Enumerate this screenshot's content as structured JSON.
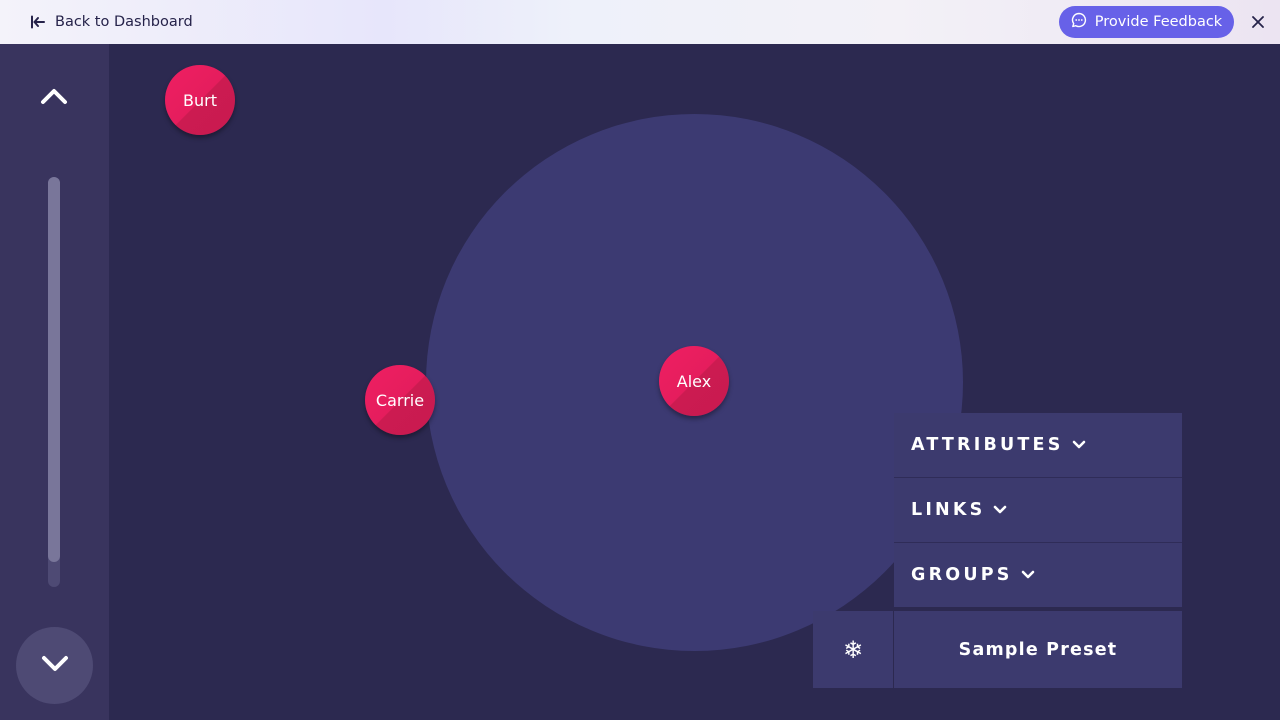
{
  "topbar": {
    "back_label": "Back to Dashboard",
    "feedback_label": "Provide Feedback",
    "accent": "#6761e8"
  },
  "sidebar": {
    "zoom_level": 0.94
  },
  "map": {
    "nodes": [
      {
        "label": "Burt"
      },
      {
        "label": "Carrie"
      },
      {
        "label": "Alex"
      }
    ],
    "node_color": "#e51d5d"
  },
  "panel": {
    "attributes_label": "ATTRIBUTES",
    "links_label": "LINKS",
    "groups_label": "GROUPS",
    "preset_label": "Sample Preset",
    "freeze_icon": "❄"
  }
}
